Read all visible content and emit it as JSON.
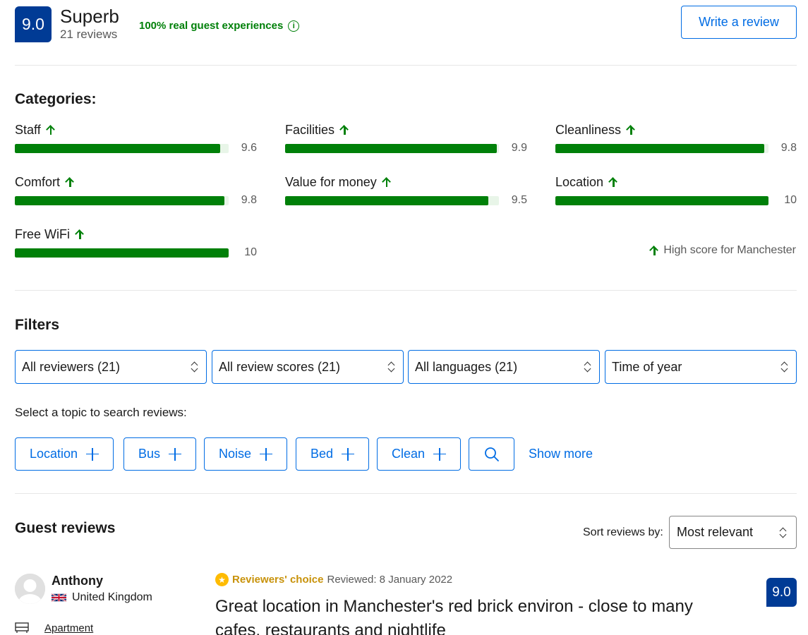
{
  "summary": {
    "score": "9.0",
    "word": "Superb",
    "count": "21 reviews",
    "real_guest": "100% real guest experiences",
    "write_review": "Write a review"
  },
  "categories": {
    "title": "Categories:",
    "items": [
      {
        "label": "Staff",
        "value": "9.6",
        "score": 9.6
      },
      {
        "label": "Facilities",
        "value": "9.9",
        "score": 9.9
      },
      {
        "label": "Cleanliness",
        "value": "9.8",
        "score": 9.8
      },
      {
        "label": "Comfort",
        "value": "9.8",
        "score": 9.8
      },
      {
        "label": "Value for money",
        "value": "9.5",
        "score": 9.5
      },
      {
        "label": "Location",
        "value": "10",
        "score": 10
      },
      {
        "label": "Free WiFi",
        "value": "10",
        "score": 10
      }
    ],
    "high_score_note": "High score for Manchester",
    "bar_color": "#008009"
  },
  "filters": {
    "title": "Filters",
    "selects": [
      "All reviewers (21)",
      "All review scores (21)",
      "All languages (21)",
      "Time of year"
    ],
    "topic_prompt": "Select a topic to search reviews:",
    "topics": [
      "Location",
      "Bus",
      "Noise",
      "Bed",
      "Clean"
    ],
    "show_more": "Show more"
  },
  "guest_reviews": {
    "title": "Guest reviews",
    "sort_label": "Sort reviews by:",
    "sort_value": "Most relevant",
    "review": {
      "name": "Anthony",
      "country": "United Kingdom",
      "room": "Apartment",
      "badge": "Reviewers' choice",
      "date": "Reviewed: 8 January 2022",
      "title": "Great location in Manchester's red brick environ - close to many cafes, restaurants and nightlife",
      "score": "9.0"
    }
  },
  "colors": {
    "brand_blue": "#003b95",
    "link_blue": "#006ce4",
    "green": "#008009"
  }
}
